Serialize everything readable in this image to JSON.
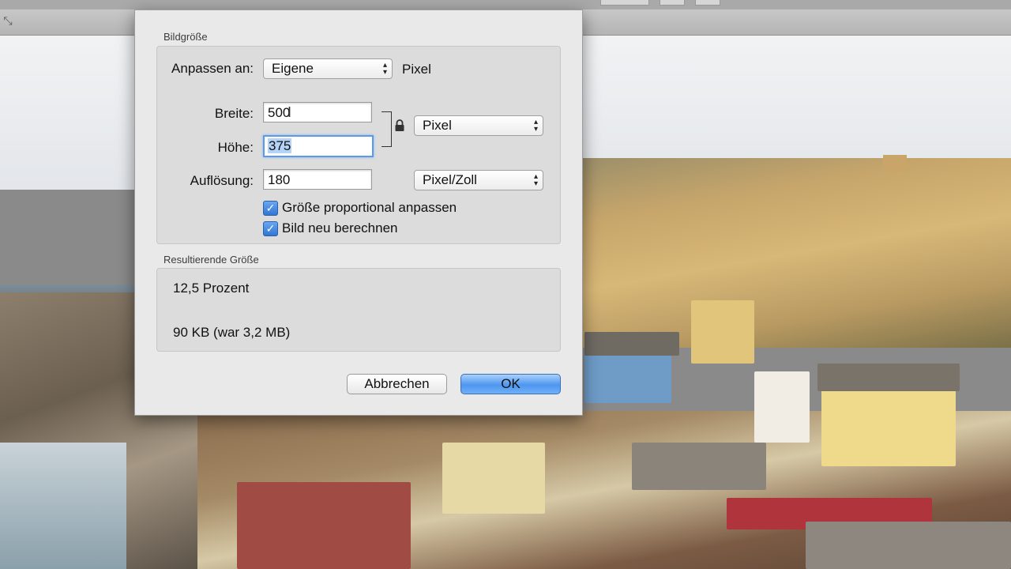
{
  "dialog": {
    "section_size_label": "Bildgröße",
    "fit_label": "Anpassen an:",
    "fit_value": "Eigene",
    "fit_unit": "Pixel",
    "width_label": "Breite:",
    "width_value": "500",
    "height_label": "Höhe:",
    "height_value": "375",
    "size_unit": "Pixel",
    "resolution_label": "Auflösung:",
    "resolution_value": "180",
    "resolution_unit": "Pixel/Zoll",
    "scale_proportionally_label": "Größe proportional anpassen",
    "scale_proportionally_checked": true,
    "resample_label": "Bild neu berechnen",
    "resample_checked": true,
    "section_result_label": "Resultierende Größe",
    "result_percent": "12,5 Prozent",
    "result_size": "90 KB (war 3,2 MB)",
    "cancel_label": "Abbrechen",
    "ok_label": "OK"
  },
  "icons": {
    "lock": "lock-icon",
    "checkbox_mark": "✓",
    "resize": "⤡"
  },
  "colors": {
    "accent": "#4d97ef",
    "focus_ring": "#5b9ae8",
    "selection": "#b4d3f7"
  }
}
